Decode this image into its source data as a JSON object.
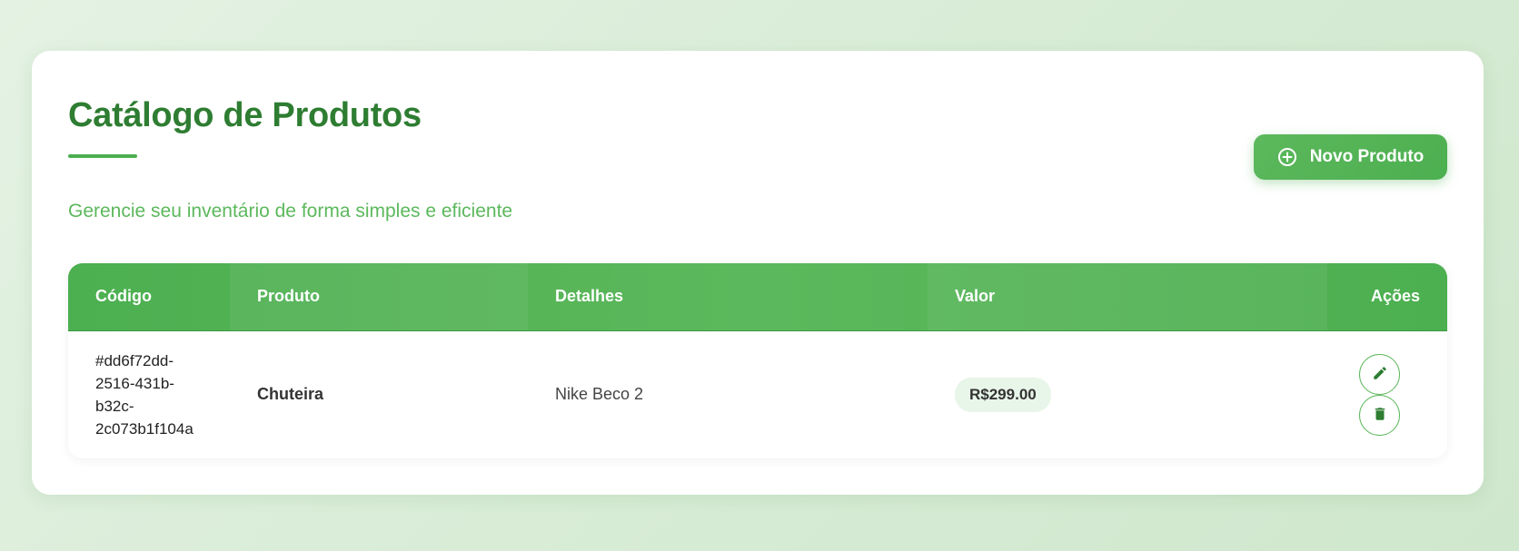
{
  "header": {
    "title": "Catálogo de Produtos",
    "subtitle": "Gerencie seu inventário de forma simples e eficiente",
    "new_button_label": "Novo Produto",
    "new_button_icon": "plus-circle-icon"
  },
  "table": {
    "columns": [
      "Código",
      "Produto",
      "Detalhes",
      "Valor",
      "Ações"
    ],
    "rows": [
      {
        "code": "#dd6f72dd-\n2516-431b-\nb32c-\n2c073b1f104a",
        "product": "Chuteira",
        "details": "Nike Beco 2",
        "price": "R$299.00",
        "actions": [
          "edit-icon",
          "trash-icon"
        ]
      }
    ]
  },
  "colors": {
    "accent": "#4caf50",
    "accent_dark": "#2e7d32",
    "accent_light": "#5cb85c",
    "price_badge_bg": "#e8f5e9"
  }
}
